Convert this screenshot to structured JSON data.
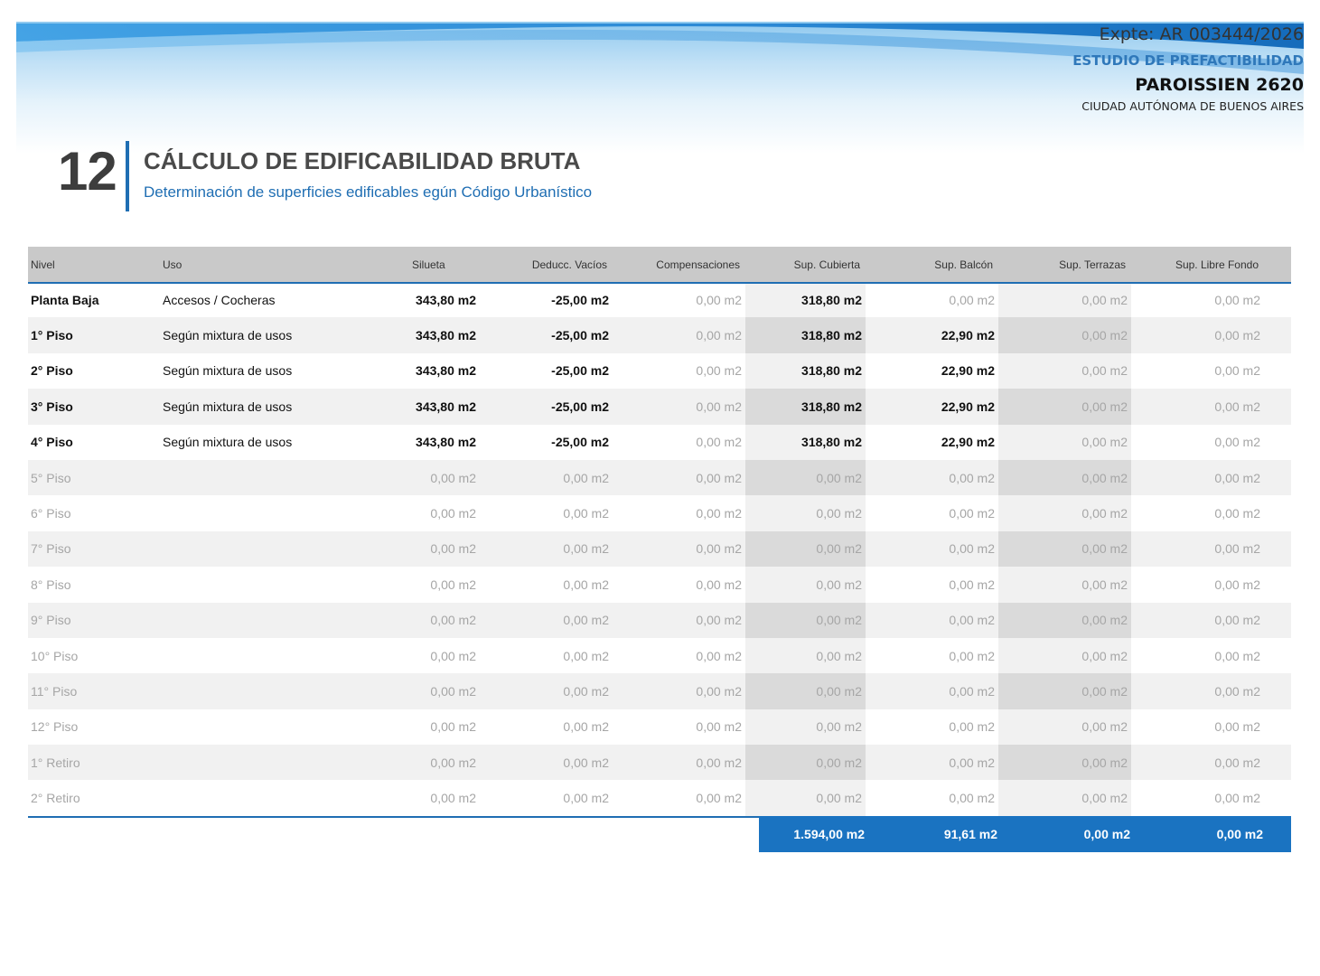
{
  "header": {
    "expte": "Expte: AR 003444/2026",
    "estudio": "ESTUDIO DE PREFACTIBILIDAD",
    "address": "PAROISSIEN 2620",
    "city": "CIUDAD AUTÓNOMA DE BUENOS AIRES"
  },
  "section": {
    "number": "12",
    "title": "CÁLCULO DE EDIFICABILIDAD BRUTA",
    "subtitle": "Determinación de superficies edificables egún Código Urbanístico"
  },
  "table": {
    "columns": [
      "Nivel",
      "Uso",
      "Silueta",
      "Deducc. Vacíos",
      "Compensaciones",
      "Sup. Cubierta",
      "Sup. Balcón",
      "Sup. Terrazas",
      "Sup. Libre Fondo"
    ],
    "rows": [
      {
        "nivel": "Planta Baja",
        "uso": "Accesos / Cocheras",
        "silueta": "343,80 m2",
        "deducc": "-25,00 m2",
        "comp": "0,00 m2",
        "cubierta": "318,80 m2",
        "balcon": "0,00 m2",
        "terrazas": "0,00 m2",
        "libre": "0,00 m2",
        "active": true,
        "balcon_active": false
      },
      {
        "nivel": "1° Piso",
        "uso": "Según mixtura de usos",
        "silueta": "343,80 m2",
        "deducc": "-25,00 m2",
        "comp": "0,00 m2",
        "cubierta": "318,80 m2",
        "balcon": "22,90 m2",
        "terrazas": "0,00 m2",
        "libre": "0,00 m2",
        "active": true,
        "balcon_active": true
      },
      {
        "nivel": "2° Piso",
        "uso": "Según mixtura de usos",
        "silueta": "343,80 m2",
        "deducc": "-25,00 m2",
        "comp": "0,00 m2",
        "cubierta": "318,80 m2",
        "balcon": "22,90 m2",
        "terrazas": "0,00 m2",
        "libre": "0,00 m2",
        "active": true,
        "balcon_active": true
      },
      {
        "nivel": "3° Piso",
        "uso": "Según mixtura de usos",
        "silueta": "343,80 m2",
        "deducc": "-25,00 m2",
        "comp": "0,00 m2",
        "cubierta": "318,80 m2",
        "balcon": "22,90 m2",
        "terrazas": "0,00 m2",
        "libre": "0,00 m2",
        "active": true,
        "balcon_active": true
      },
      {
        "nivel": "4° Piso",
        "uso": "Según mixtura de usos",
        "silueta": "343,80 m2",
        "deducc": "-25,00 m2",
        "comp": "0,00 m2",
        "cubierta": "318,80 m2",
        "balcon": "22,90 m2",
        "terrazas": "0,00 m2",
        "libre": "0,00 m2",
        "active": true,
        "balcon_active": true
      },
      {
        "nivel": "5° Piso",
        "uso": "",
        "silueta": "0,00 m2",
        "deducc": "0,00 m2",
        "comp": "0,00 m2",
        "cubierta": "0,00 m2",
        "balcon": "0,00 m2",
        "terrazas": "0,00 m2",
        "libre": "0,00 m2",
        "active": false,
        "balcon_active": false
      },
      {
        "nivel": "6° Piso",
        "uso": "",
        "silueta": "0,00 m2",
        "deducc": "0,00 m2",
        "comp": "0,00 m2",
        "cubierta": "0,00 m2",
        "balcon": "0,00 m2",
        "terrazas": "0,00 m2",
        "libre": "0,00 m2",
        "active": false,
        "balcon_active": false
      },
      {
        "nivel": "7° Piso",
        "uso": "",
        "silueta": "0,00 m2",
        "deducc": "0,00 m2",
        "comp": "0,00 m2",
        "cubierta": "0,00 m2",
        "balcon": "0,00 m2",
        "terrazas": "0,00 m2",
        "libre": "0,00 m2",
        "active": false,
        "balcon_active": false
      },
      {
        "nivel": "8° Piso",
        "uso": "",
        "silueta": "0,00 m2",
        "deducc": "0,00 m2",
        "comp": "0,00 m2",
        "cubierta": "0,00 m2",
        "balcon": "0,00 m2",
        "terrazas": "0,00 m2",
        "libre": "0,00 m2",
        "active": false,
        "balcon_active": false
      },
      {
        "nivel": "9° Piso",
        "uso": "",
        "silueta": "0,00 m2",
        "deducc": "0,00 m2",
        "comp": "0,00 m2",
        "cubierta": "0,00 m2",
        "balcon": "0,00 m2",
        "terrazas": "0,00 m2",
        "libre": "0,00 m2",
        "active": false,
        "balcon_active": false
      },
      {
        "nivel": "10° Piso",
        "uso": "",
        "silueta": "0,00 m2",
        "deducc": "0,00 m2",
        "comp": "0,00 m2",
        "cubierta": "0,00 m2",
        "balcon": "0,00 m2",
        "terrazas": "0,00 m2",
        "libre": "0,00 m2",
        "active": false,
        "balcon_active": false
      },
      {
        "nivel": "11° Piso",
        "uso": "",
        "silueta": "0,00 m2",
        "deducc": "0,00 m2",
        "comp": "0,00 m2",
        "cubierta": "0,00 m2",
        "balcon": "0,00 m2",
        "terrazas": "0,00 m2",
        "libre": "0,00 m2",
        "active": false,
        "balcon_active": false
      },
      {
        "nivel": "12° Piso",
        "uso": "",
        "silueta": "0,00 m2",
        "deducc": "0,00 m2",
        "comp": "0,00 m2",
        "cubierta": "0,00 m2",
        "balcon": "0,00 m2",
        "terrazas": "0,00 m2",
        "libre": "0,00 m2",
        "active": false,
        "balcon_active": false
      },
      {
        "nivel": "1° Retiro",
        "uso": "",
        "silueta": "0,00 m2",
        "deducc": "0,00 m2",
        "comp": "0,00 m2",
        "cubierta": "0,00 m2",
        "balcon": "0,00 m2",
        "terrazas": "0,00 m2",
        "libre": "0,00 m2",
        "active": false,
        "balcon_active": false
      },
      {
        "nivel": "2° Retiro",
        "uso": "",
        "silueta": "0,00 m2",
        "deducc": "0,00 m2",
        "comp": "0,00 m2",
        "cubierta": "0,00 m2",
        "balcon": "0,00 m2",
        "terrazas": "0,00 m2",
        "libre": "0,00 m2",
        "active": false,
        "balcon_active": false
      }
    ],
    "totals": {
      "cubierta": "1.594,00 m2",
      "balcon": "91,61 m2",
      "terrazas": "0,00 m2",
      "libre": "0,00 m2"
    }
  },
  "colors": {
    "accent": "#1f6eb3",
    "totals_bg": "#1a73c1",
    "header_row": "#c9c9c9",
    "inactive_text": "#a6a6a6"
  }
}
